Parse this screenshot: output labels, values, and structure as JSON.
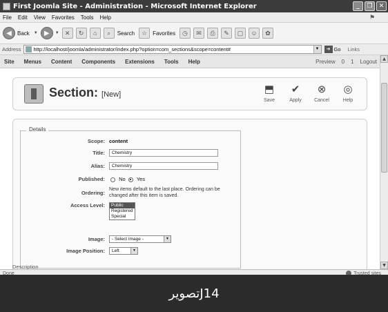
{
  "window": {
    "title": "First Joomla Site - Administration - Microsoft Internet Explorer",
    "controls": [
      "_",
      "❐",
      "✕"
    ]
  },
  "menubar": [
    "File",
    "Edit",
    "View",
    "Favorites",
    "Tools",
    "Help"
  ],
  "toolbar": {
    "back": "Back",
    "search": "Search",
    "favorites": "Favorites"
  },
  "address": {
    "label": "Address",
    "url": "http://localhost/joomla/administrator/index.php?option=com_sections&scope=content#",
    "go": "Go",
    "links": "Links"
  },
  "joomla_menu": {
    "items": [
      "Site",
      "Menus",
      "Content",
      "Components",
      "Extensions",
      "Tools",
      "Help"
    ],
    "right": [
      "Preview",
      "0",
      "1",
      "Logout"
    ]
  },
  "header": {
    "title": "Section:",
    "subtitle": "[New]",
    "actions": [
      {
        "label": "Save",
        "icon": "save-icon"
      },
      {
        "label": "Apply",
        "icon": "apply-icon"
      },
      {
        "label": "Cancel",
        "icon": "cancel-icon"
      },
      {
        "label": "Help",
        "icon": "help-icon"
      }
    ]
  },
  "form": {
    "legend": "Details",
    "scope_label": "Scope:",
    "scope_value": "content",
    "title_label": "Title:",
    "title_value": "Chemistry",
    "alias_label": "Alias:",
    "alias_value": "Chemistry",
    "published_label": "Published:",
    "published_no": "No",
    "published_yes": "Yes",
    "ordering_label": "Ordering:",
    "ordering_note": "New items default to the last place. Ordering can be changed after this item is saved.",
    "access_label": "Access Level:",
    "access_options": [
      "Public",
      "Registered",
      "Special"
    ],
    "access_selected": "Public",
    "image_label": "Image:",
    "image_value": "- Select Image -",
    "image_position_label": "Image Position:",
    "image_position_value": "Left",
    "description_legend": "Description"
  },
  "status": {
    "left": "Done",
    "right": "Trusted sites"
  },
  "caption": "تصویرJ14"
}
